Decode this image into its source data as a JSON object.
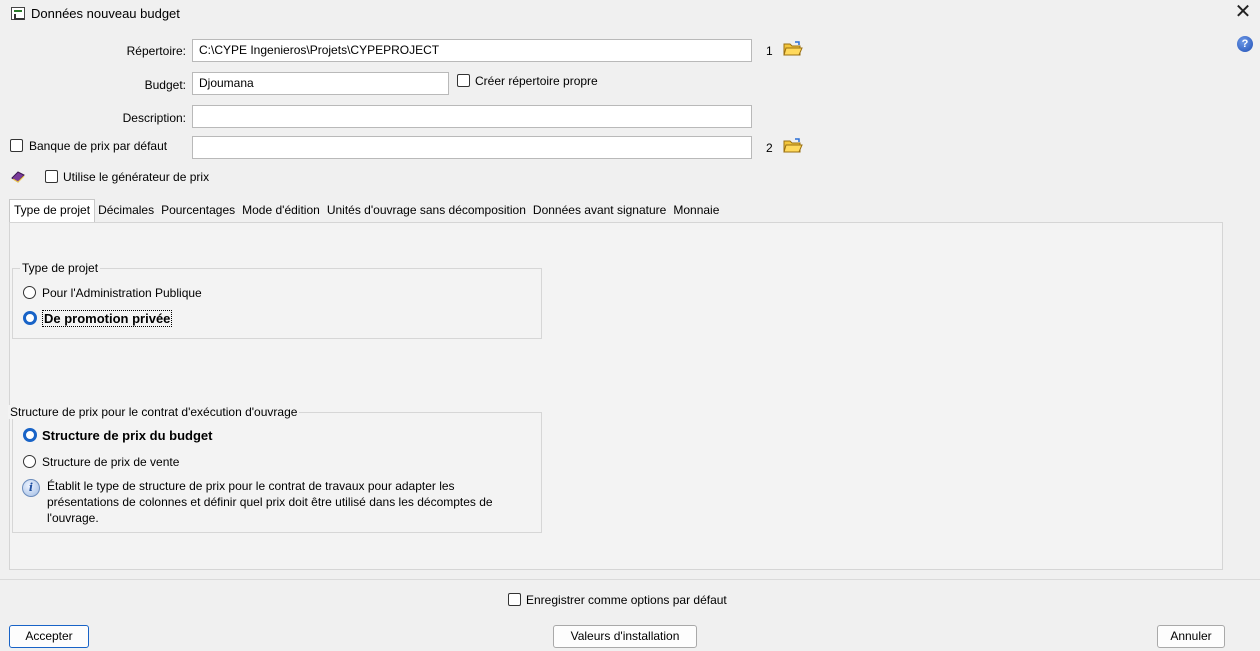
{
  "window": {
    "title": "Données nouveau budget",
    "close_glyph": "✕",
    "help_glyph": "?"
  },
  "form": {
    "repertoire_label": "Répertoire:",
    "repertoire_value": "C:\\CYPE Ingenieros\\Projets\\CYPEPROJECT",
    "repertoire_num": "1",
    "budget_label": "Budget:",
    "budget_value": "Djoumana",
    "creer_repertoire_label": "Créer répertoire propre",
    "description_label": "Description:",
    "description_value": "",
    "banque_label": "Banque de prix par défaut",
    "banque_value": "",
    "banque_num": "2",
    "generateur_label": "Utilise le générateur de prix"
  },
  "tabs": [
    {
      "label": "Type de projet",
      "active": true
    },
    {
      "label": "Décimales",
      "active": false
    },
    {
      "label": "Pourcentages",
      "active": false
    },
    {
      "label": "Mode d'édition",
      "active": false
    },
    {
      "label": "Unités d'ouvrage sans décomposition",
      "active": false
    },
    {
      "label": "Données avant signature",
      "active": false
    },
    {
      "label": "Monnaie",
      "active": false
    }
  ],
  "type_projet": {
    "title": "Type de projet",
    "options": [
      {
        "label": "Pour l'Administration Publique",
        "selected": false
      },
      {
        "label": "De promotion privée",
        "selected": true
      }
    ]
  },
  "structure_prix": {
    "title": "Structure de prix pour le contrat d'exécution d'ouvrage",
    "options": [
      {
        "label": "Structure de prix du budget",
        "selected": true
      },
      {
        "label": "Structure de prix de vente",
        "selected": false
      }
    ],
    "info_lines": [
      "Établit le type de structure de prix pour le contrat de travaux pour adapter les",
      "présentations de colonnes et définir quel prix doit être utilisé dans les décomptes de",
      "l'ouvrage."
    ]
  },
  "footer": {
    "enregistrer_label": "Enregistrer comme options par défaut",
    "accepter": "Accepter",
    "valeurs": "Valeurs d'installation",
    "annuler": "Annuler"
  },
  "colors": {
    "accent": "#1863c7",
    "background": "#f0f0f0",
    "field_bg": "#ffffff"
  },
  "icons": {
    "folder": "folder-open-icon",
    "book": "book-icon",
    "info": "info-icon",
    "help": "help-icon"
  }
}
